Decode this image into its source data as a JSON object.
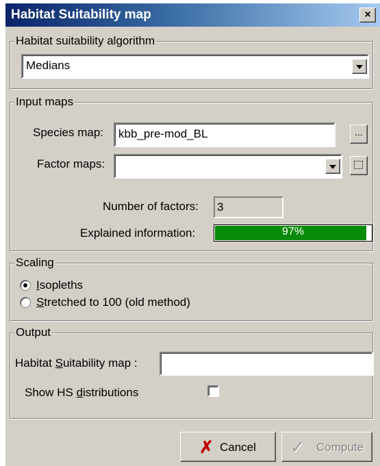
{
  "window": {
    "title": "Habitat Suitability map",
    "close_label": "×"
  },
  "algorithm": {
    "legend": "Habitat suitability algorithm",
    "selected": "Medians"
  },
  "input_maps": {
    "legend": "Input maps",
    "species_label": "Species map:",
    "species_value": "kbb_pre-mod_BL",
    "browse_label": "...",
    "factor_label": "Factor maps:",
    "factor_value": "",
    "num_factors_label": "Number of factors:",
    "num_factors_value": "3",
    "explained_label": "Explained information:",
    "explained_value": "97%",
    "explained_fraction": 0.97,
    "fill_color": "#0a8a0a"
  },
  "scaling": {
    "legend": "Scaling",
    "option1_first": "I",
    "option1_rest": "sopleths",
    "option2_first": "S",
    "option2_rest": "tretched to 100 (old method)",
    "selected": "Isopleths"
  },
  "output": {
    "legend": "Output",
    "hs_label_a": "Habitat ",
    "hs_label_u": "S",
    "hs_label_b": "uitability map :",
    "hs_value": "",
    "show_label_a": "Show HS ",
    "show_label_u": "d",
    "show_label_b": "istributions",
    "show_checked": false
  },
  "buttons": {
    "cancel_label": "Cancel",
    "compute_label": "Compute"
  },
  "colors": {
    "titlebar_start": "#0a246a",
    "titlebar_end": "#a6caf0",
    "face": "#d4d0c8"
  }
}
